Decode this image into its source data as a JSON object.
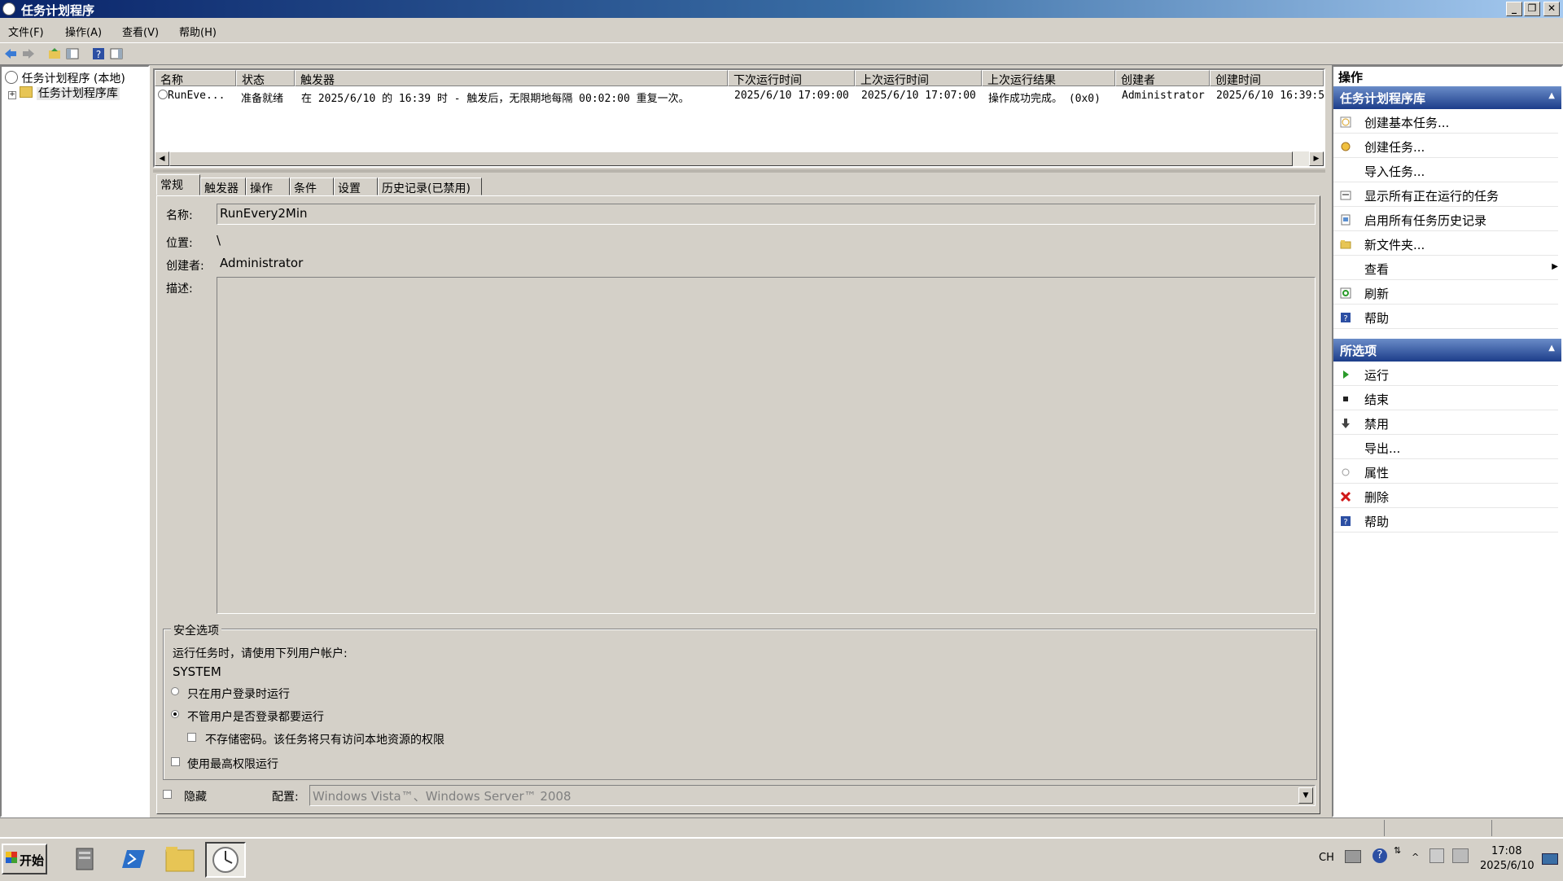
{
  "window": {
    "title": "任务计划程序"
  },
  "menu": [
    "文件(F)",
    "操作(A)",
    "查看(V)",
    "帮助(H)"
  ],
  "tree": {
    "root": "任务计划程序 (本地)",
    "child": "任务计划程序库"
  },
  "list": {
    "columns": [
      "名称",
      "状态",
      "触发器",
      "下次运行时间",
      "上次运行时间",
      "上次运行结果",
      "创建者",
      "创建时间"
    ],
    "row": {
      "name": "RunEve...",
      "status": "准备就绪",
      "trigger": "在 2025/6/10 的 16:39 时 - 触发后，无限期地每隔 00:02:00 重复一次。",
      "next_run": "2025/6/10 17:09:00",
      "last_run": "2025/6/10 17:07:00",
      "last_result": "操作成功完成。 (0x0)",
      "author": "Administrator",
      "created": "2025/6/10 16:39:5"
    }
  },
  "tabs": [
    "常规",
    "触发器",
    "操作",
    "条件",
    "设置",
    "历史记录(已禁用)"
  ],
  "general": {
    "name_label": "名称:",
    "name_value": "RunEvery2Min",
    "location_label": "位置:",
    "location_value": "\\",
    "author_label": "创建者:",
    "author_value": "Administrator",
    "desc_label": "描述:",
    "desc_value": "",
    "security_title": "安全选项",
    "run_as_prompt": "运行任务时，请使用下列用户帐户:",
    "run_as_user": "SYSTEM",
    "radio_logged_on": "只在用户登录时运行",
    "radio_always": "不管用户是否登录都要运行",
    "no_store_password": "不存储密码。该任务将只有访问本地资源的权限",
    "highest_privileges": "使用最高权限运行",
    "hidden_label": "隐藏",
    "config_label": "配置:",
    "config_value": "Windows Vista™、Windows Server™ 2008"
  },
  "actions": {
    "header": "操作",
    "section1": "任务计划程序库",
    "section1_items": [
      "创建基本任务...",
      "创建任务...",
      "导入任务...",
      "显示所有正在运行的任务",
      "启用所有任务历史记录",
      "新文件夹...",
      "查看",
      "刷新",
      "帮助"
    ],
    "section2": "所选项",
    "section2_items": [
      "运行",
      "结束",
      "禁用",
      "导出...",
      "属性",
      "删除",
      "帮助"
    ]
  },
  "taskbar": {
    "start": "开始",
    "lang": "CH",
    "time": "17:08",
    "date": "2025/6/10"
  },
  "colors": {
    "title_start": "#0a246a",
    "title_end": "#a6caf0",
    "face": "#d4d0c8",
    "action_header": "#1c3d8a"
  },
  "icons": [
    "clock-icon",
    "back-icon",
    "forward-icon",
    "up-folder-icon",
    "show-hide-tree-icon",
    "help-icon",
    "properties-icon"
  ]
}
